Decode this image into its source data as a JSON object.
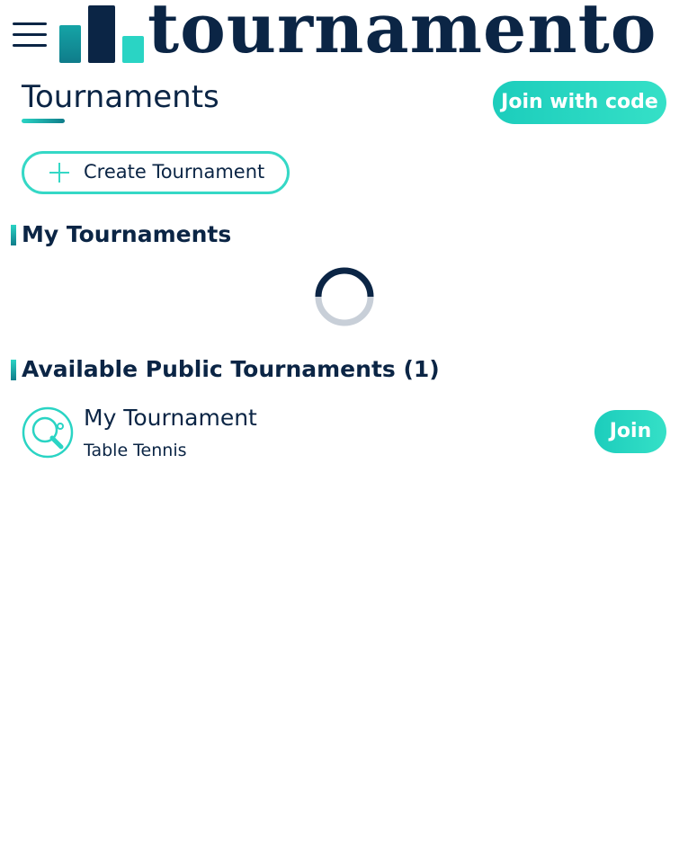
{
  "header": {
    "logo_text": "tournamento",
    "menu_icon": "hamburger-menu-icon",
    "colors": {
      "navy": "#0b2545",
      "accent": "#2ad4c4"
    }
  },
  "page": {
    "title": "Tournaments",
    "join_with_code_label": "Join with code",
    "create_tournament_label": "Create Tournament"
  },
  "my_tournaments": {
    "heading": "My Tournaments",
    "loading": true
  },
  "public_tournaments": {
    "heading": "Available Public Tournaments (1)",
    "items": [
      {
        "name": "My Tournament",
        "sport": "Table Tennis",
        "icon": "table-tennis-icon",
        "join_label": "Join"
      }
    ]
  }
}
